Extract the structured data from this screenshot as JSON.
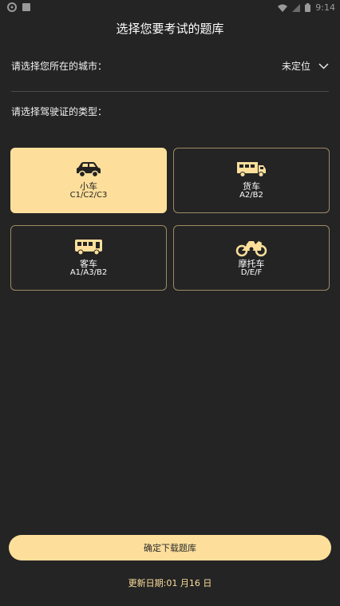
{
  "status_bar": {
    "time": "9:14"
  },
  "header": {
    "title": "选择您要考试的题库"
  },
  "city": {
    "label": "请选择您所在的城市：",
    "value": "未定位"
  },
  "license": {
    "label": "请选择驾驶证的类型："
  },
  "cards": [
    {
      "title": "小车",
      "sub": "C1/C2/C3",
      "icon": "car-icon",
      "selected": true
    },
    {
      "title": "货车",
      "sub": "A2/B2",
      "icon": "truck-icon",
      "selected": false
    },
    {
      "title": "客车",
      "sub": "A1/A3/B2",
      "icon": "bus-icon",
      "selected": false
    },
    {
      "title": "摩托车",
      "sub": "D/E/F",
      "icon": "motorcycle-icon",
      "selected": false
    }
  ],
  "footer": {
    "button_label": "确定下载题库",
    "update_text": "更新日期:01 月16 日"
  },
  "colors": {
    "accent": "#fddf9b",
    "background": "#242424",
    "card_border": "#9c8a63"
  }
}
